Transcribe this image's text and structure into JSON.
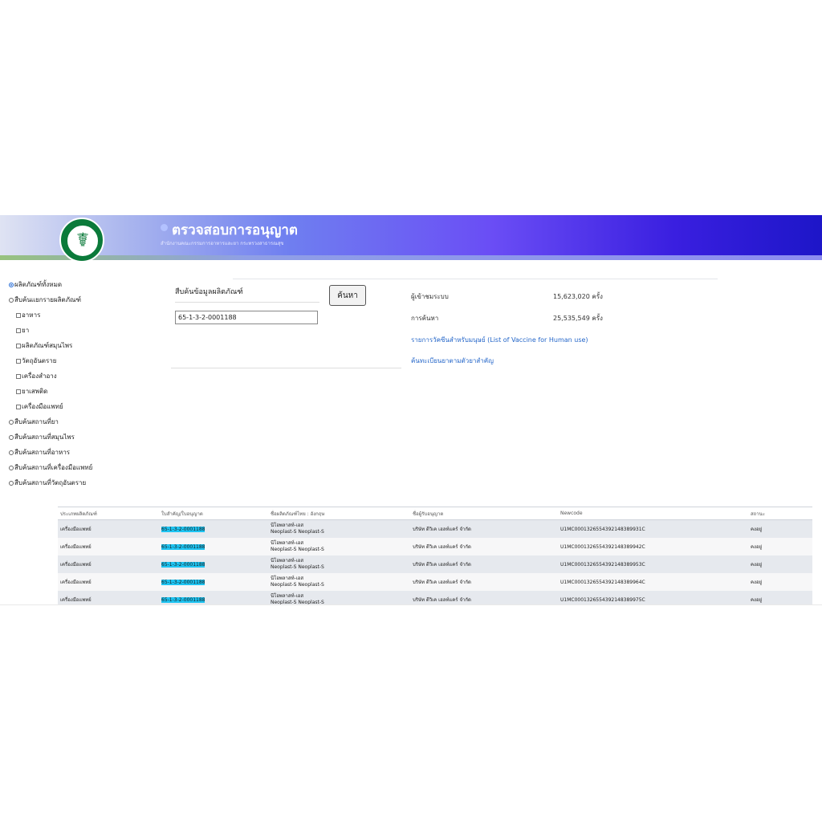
{
  "header": {
    "title": "ตรวจสอบการอนุญาต",
    "subtitle": "สำนักงานคณะกรรมการอาหารและยา กระทรวงสาธารณสุข",
    "logo_text": "MINISTRY OF PUBLIC HEALTH",
    "colors": {
      "banner_start": "#dfe3f3",
      "banner_end": "#1d16c8",
      "logo": "#0b7a3a"
    }
  },
  "sidebar": {
    "items": [
      {
        "type": "radio",
        "checked": true,
        "label": "ผลิตภัณฑ์ทั้งหมด"
      },
      {
        "type": "radio",
        "checked": false,
        "label": "สืบค้นแยกรายผลิตภัณฑ์"
      },
      {
        "type": "checkbox",
        "checked": false,
        "label": "อาหาร"
      },
      {
        "type": "checkbox",
        "checked": false,
        "label": "ยา"
      },
      {
        "type": "checkbox",
        "checked": false,
        "label": "ผลิตภัณฑ์สมุนไพร"
      },
      {
        "type": "checkbox",
        "checked": false,
        "label": "วัตถุอันตราย"
      },
      {
        "type": "checkbox",
        "checked": false,
        "label": "เครื่องสำอาง"
      },
      {
        "type": "checkbox",
        "checked": false,
        "label": "ยาเสพติด"
      },
      {
        "type": "checkbox",
        "checked": false,
        "label": "เครื่องมือแพทย์"
      },
      {
        "type": "radio",
        "checked": false,
        "label": "สืบค้นสถานที่ยา"
      },
      {
        "type": "radio",
        "checked": false,
        "label": "สืบค้นสถานที่สมุนไพร"
      },
      {
        "type": "radio",
        "checked": false,
        "label": "สืบค้นสถานที่อาหาร"
      },
      {
        "type": "radio",
        "checked": false,
        "label": "สืบค้นสถานที่เครื่องมือแพทย์"
      },
      {
        "type": "radio",
        "checked": false,
        "label": "สืบค้นสถานที่วัตถุอันตราย"
      }
    ]
  },
  "search": {
    "label": "สืบค้นข้อมูลผลิตภัณฑ์",
    "value": "65-1-3-2-0001188",
    "button_label": "ค้นหา"
  },
  "stats": {
    "visitors_label": "ผู้เข้าชมระบบ",
    "visitors_value": "15,623,020 ครั้ง",
    "searches_label": "การค้นหา",
    "searches_value": "25,535,549 ครั้ง"
  },
  "links": {
    "vaccine": "รายการวัคซีนสำหรับมนุษย์ (List of Vaccine for Human use)",
    "drug_register": "ค้นทะเบียนยาตามตัวยาสำคัญ"
  },
  "table": {
    "headers": [
      "ประเภทผลิตภัณฑ์",
      "ใบสำคัญ/ใบอนุญาต",
      "ชื่อผลิตภัณฑ์ไทย : อังกฤษ",
      "ชื่อผู้รับอนุญาต",
      "Newcode",
      "สถานะ"
    ],
    "rows": [
      {
        "type": "เครื่องมือแพทย์",
        "license": "65-1-3-2-0001188",
        "name_th": "นีโอพลาสท์-เอส",
        "name_en": "Neoplast-S Neoplast-S",
        "licensee": "บริษัท ดีวิเค เฮลท์แคร์ จำกัด",
        "newcode": "U1MC0001326554392148389931C",
        "status": "คงอยู่"
      },
      {
        "type": "เครื่องมือแพทย์",
        "license": "65-1-3-2-0001188",
        "name_th": "นีโอพลาสท์-เอส",
        "name_en": "Neoplast-S Neoplast-S",
        "licensee": "บริษัท ดีวิเค เฮลท์แคร์ จำกัด",
        "newcode": "U1MC0001326554392148389942C",
        "status": "คงอยู่"
      },
      {
        "type": "เครื่องมือแพทย์",
        "license": "65-1-3-2-0001188",
        "name_th": "นีโอพลาสท์-เอส",
        "name_en": "Neoplast-S Neoplast-S",
        "licensee": "บริษัท ดีวิเค เฮลท์แคร์ จำกัด",
        "newcode": "U1MC0001326554392148389953C",
        "status": "คงอยู่"
      },
      {
        "type": "เครื่องมือแพทย์",
        "license": "65-1-3-2-0001188",
        "name_th": "นีโอพลาสท์-เอส",
        "name_en": "Neoplast-S Neoplast-S",
        "licensee": "บริษัท ดีวิเค เฮลท์แคร์ จำกัด",
        "newcode": "U1MC0001326554392148389964C",
        "status": "คงอยู่"
      },
      {
        "type": "เครื่องมือแพทย์",
        "license": "65-1-3-2-0001188",
        "name_th": "นีโอพลาสท์-เอส",
        "name_en": "Neoplast-S Neoplast-S",
        "licensee": "บริษัท ดีวิเค เฮลท์แคร์ จำกัด",
        "newcode": "U1MC0001326554392148389975C",
        "status": "คงอยู่"
      }
    ]
  }
}
